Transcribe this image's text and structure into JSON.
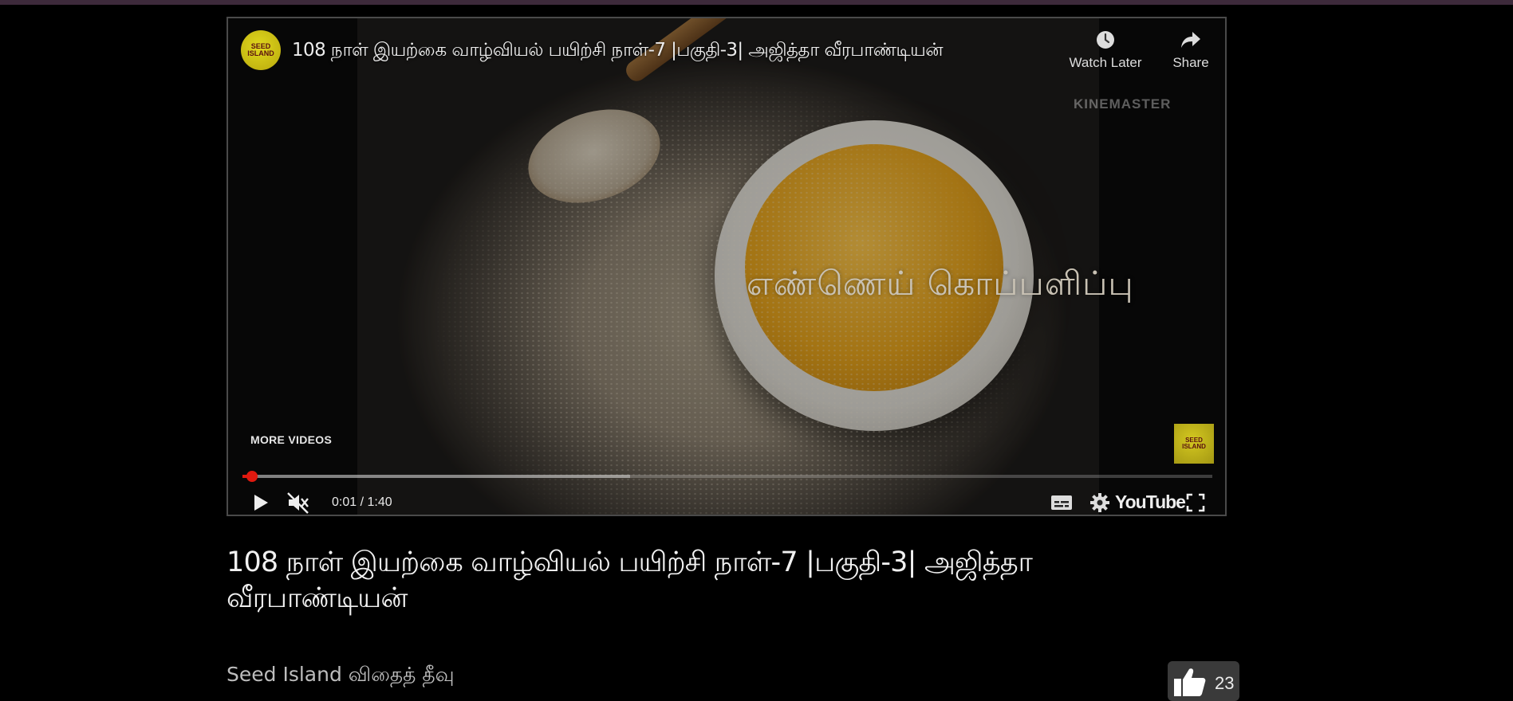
{
  "player": {
    "channel_logo_text": "SEED ISLAND",
    "overlay_title": "108 நாள் இயற்கை வாழ்வியல் பயிற்சி நாள்-7 |பகுதி-3| அஜித்தா வீரபாண்டியன்",
    "watch_later_label": "Watch Later",
    "share_label": "Share",
    "watermark": "KINEMASTER",
    "video_caption": "எண்ணெய் கொப்பளிப்பு",
    "more_videos_label": "MORE VIDEOS",
    "corner_logo_text": "SEED ISLAND",
    "time_display": "0:01 / 1:40",
    "progress": {
      "played_fraction": 0.01,
      "buffered_fraction": 0.4
    },
    "youtube_label": "YouTube"
  },
  "video_info": {
    "title": "108 நாள் இயற்கை வாழ்வியல் பயிற்சி நாள்-7 |பகுதி-3| அஜித்தா வீரபாண்டியன்",
    "channel_name": "Seed Island விதைத் தீவு",
    "like_count": "23"
  },
  "icons": [
    "clock-icon",
    "share-arrow-icon",
    "play-icon",
    "muted-volume-icon",
    "subtitles-icon",
    "gear-icon",
    "fullscreen-icon",
    "thumbs-up-icon"
  ],
  "colors": {
    "progress_red": "#e0190f",
    "top_strip": "#3d2a3b",
    "background": "#000000"
  }
}
